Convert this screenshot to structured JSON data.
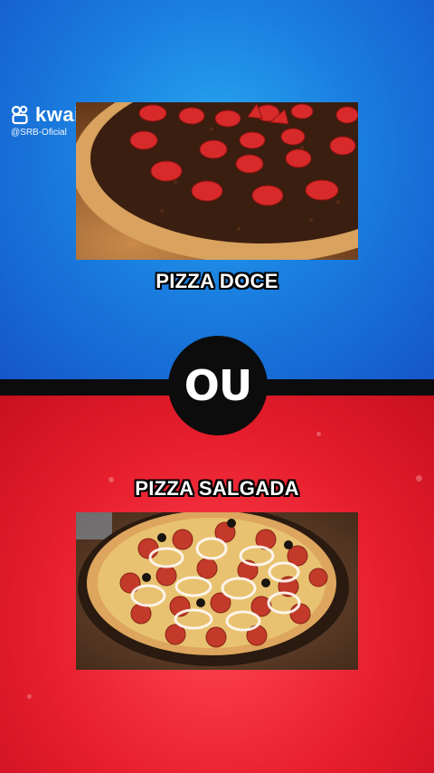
{
  "watermark": {
    "brand": "kwai",
    "handle": "@SRB-Oficial",
    "icon": "kwai-logo-icon"
  },
  "options": {
    "sweet": {
      "label": "PIZZA DOCE"
    },
    "savory": {
      "label": "PIZZA SALGADA"
    }
  },
  "separator": {
    "text": "OU"
  },
  "colors": {
    "top_background": "#1a7fe0",
    "bottom_background": "#e81f2e",
    "divider": "#0c0c0c"
  }
}
